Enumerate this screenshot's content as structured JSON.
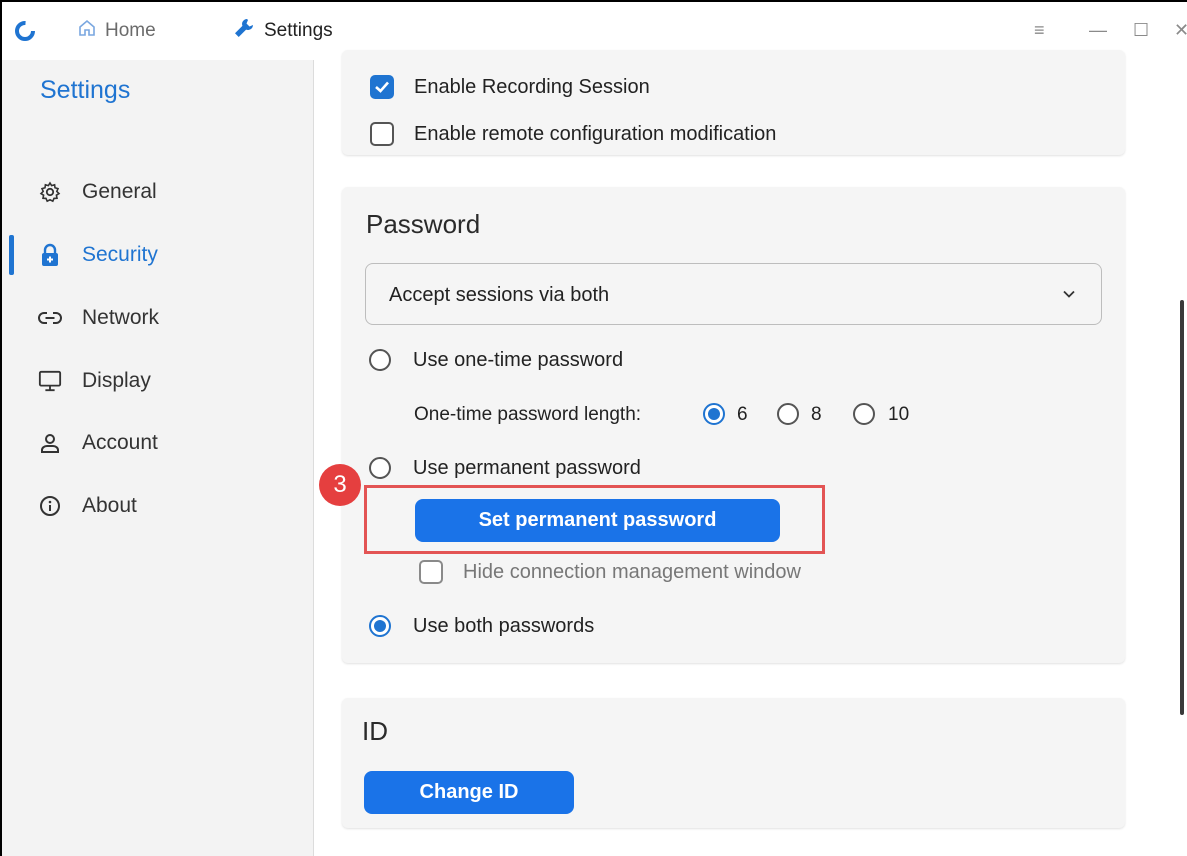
{
  "titlebar": {
    "home_tab": "Home",
    "settings_tab": "Settings",
    "menu_icon": "≡",
    "minimize_icon": "—",
    "maximize_icon": "☐",
    "close_icon": "✕"
  },
  "sidebar": {
    "title": "Settings",
    "items": [
      {
        "label": "General",
        "icon": "gear-icon"
      },
      {
        "label": "Security",
        "icon": "lock-icon",
        "active": true
      },
      {
        "label": "Network",
        "icon": "link-icon"
      },
      {
        "label": "Display",
        "icon": "monitor-icon"
      },
      {
        "label": "Account",
        "icon": "user-icon"
      },
      {
        "label": "About",
        "icon": "info-icon"
      }
    ]
  },
  "top_card": {
    "enable_recording": {
      "label": "Enable Recording Session",
      "checked": true
    },
    "enable_remote_config": {
      "label": "Enable remote configuration modification",
      "checked": false
    }
  },
  "password_card": {
    "title": "Password",
    "accept_select": {
      "value": "Accept sessions via both"
    },
    "one_time": {
      "label": "Use one-time password",
      "selected": false
    },
    "otp_length": {
      "label": "One-time password length:",
      "options": [
        "6",
        "8",
        "10"
      ],
      "selected": "6"
    },
    "permanent": {
      "label": "Use permanent password",
      "selected": false
    },
    "set_permanent_button": "Set permanent password",
    "hide_cm_window": {
      "label": "Hide connection management window",
      "checked": false
    },
    "both": {
      "label": "Use both passwords",
      "selected": true
    }
  },
  "id_card": {
    "title": "ID",
    "change_id_button": "Change ID"
  },
  "annotation": {
    "step_number": "3"
  },
  "colors": {
    "accent": "#1f74d1",
    "button": "#1a73e8",
    "highlight": "#e35454"
  }
}
